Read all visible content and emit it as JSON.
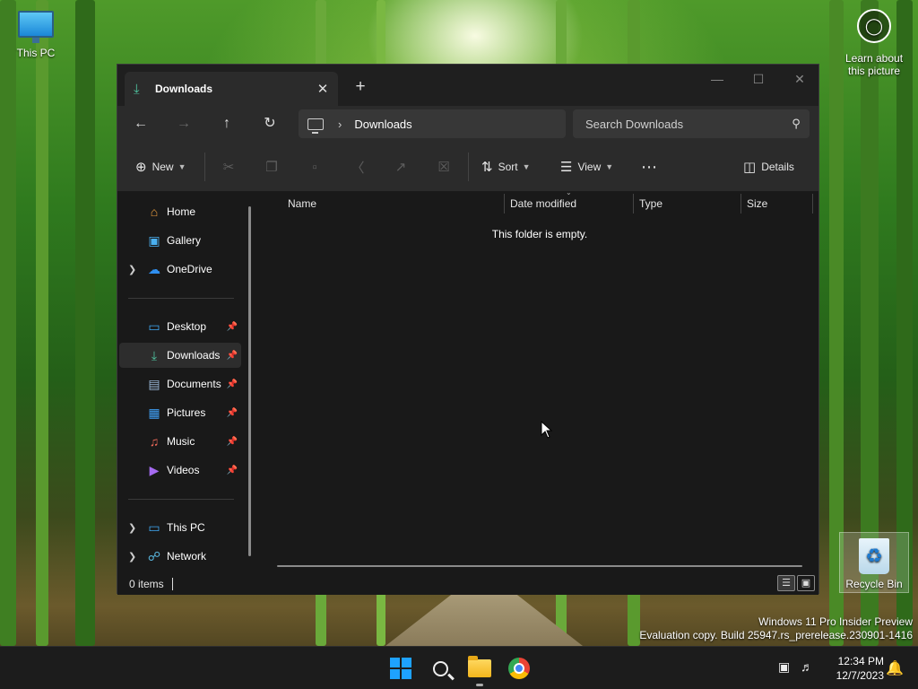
{
  "desktop": {
    "this_pc_label": "This PC",
    "recycle_bin_label": "Recycle Bin",
    "learn_label": "Learn about this picture",
    "watermark_line1": "Windows 11 Pro Insider Preview",
    "watermark_line2": "Evaluation copy. Build 25947.rs_prerelease.230901-1416"
  },
  "window": {
    "tab_title": "Downloads",
    "breadcrumb": "Downloads",
    "search_placeholder": "Search Downloads"
  },
  "toolbar": {
    "new_label": "New",
    "sort_label": "Sort",
    "view_label": "View",
    "details_label": "Details"
  },
  "nav": {
    "items": [
      {
        "label": "Home",
        "icon": "home-icon"
      },
      {
        "label": "Gallery",
        "icon": "gallery-icon"
      },
      {
        "label": "OneDrive",
        "icon": "cloud-icon"
      },
      {
        "label": "Desktop",
        "icon": "desktop-icon"
      },
      {
        "label": "Downloads",
        "icon": "download-icon"
      },
      {
        "label": "Documents",
        "icon": "document-icon"
      },
      {
        "label": "Pictures",
        "icon": "pictures-icon"
      },
      {
        "label": "Music",
        "icon": "music-icon"
      },
      {
        "label": "Videos",
        "icon": "video-icon"
      },
      {
        "label": "This PC",
        "icon": "computer-icon"
      },
      {
        "label": "Network",
        "icon": "network-icon"
      }
    ]
  },
  "columns": {
    "name": "Name",
    "date_modified": "Date modified",
    "type": "Type",
    "size": "Size"
  },
  "content": {
    "empty_message": "This folder is empty."
  },
  "status": {
    "item_count": "0 items"
  },
  "taskbar": {
    "time": "12:34 PM",
    "date": "12/7/2023"
  },
  "colors": {
    "accent": "#1ea2ff",
    "window_bg": "#191919",
    "toolbar_bg": "#2b2b2b"
  }
}
